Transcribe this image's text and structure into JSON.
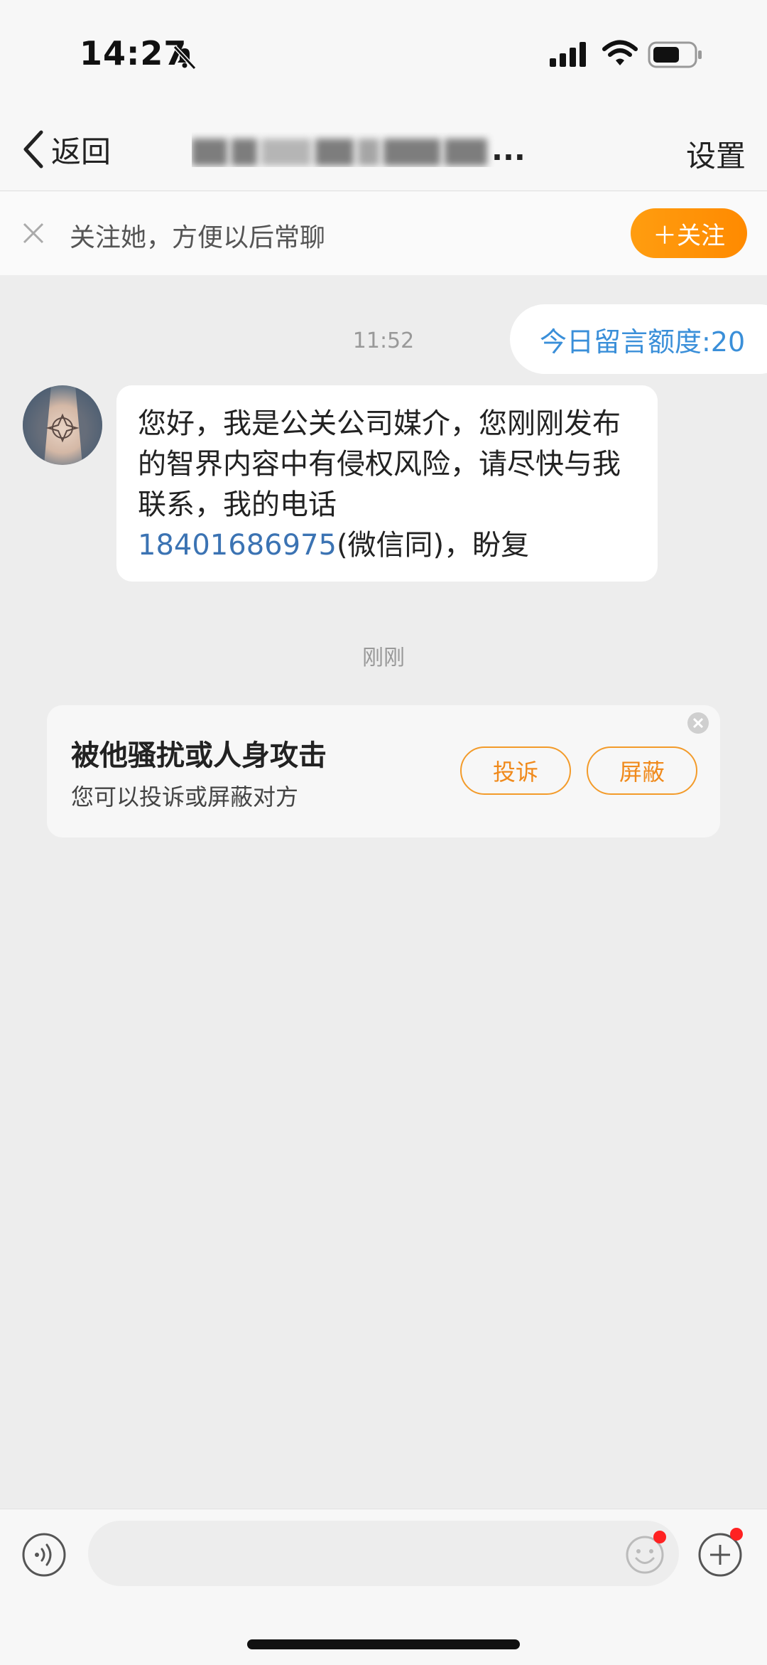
{
  "status_bar": {
    "time": "14:27"
  },
  "nav": {
    "back_label": "返回",
    "title_suffix": "...",
    "settings_label": "设置"
  },
  "follow_bar": {
    "text": "关注她，方便以后常聊",
    "button_label": "＋关注"
  },
  "chat": {
    "quota": "今日留言额度:20",
    "time_1": "11:52",
    "message": {
      "text_before_phone": "您好，我是公关公司媒介，您刚刚发布的智界内容中有侵权风险，请尽快与我联系，我的电话",
      "phone": "18401686975",
      "text_after_phone": "(微信同)，盼复"
    },
    "time_2": "刚刚"
  },
  "report_card": {
    "title": "被他骚扰或人身攻击",
    "subtitle": "您可以投诉或屏蔽对方",
    "complain_label": "投诉",
    "block_label": "屏蔽"
  },
  "colors": {
    "accent_orange": "#ff8a00",
    "link_blue": "#3b73b3",
    "quota_blue": "#3a8fd9"
  },
  "icons": [
    "bell-slash-icon",
    "signal-icon",
    "wifi-icon",
    "battery-icon",
    "chevron-left-icon",
    "close-icon",
    "voice-icon",
    "emoji-icon",
    "plus-icon"
  ]
}
